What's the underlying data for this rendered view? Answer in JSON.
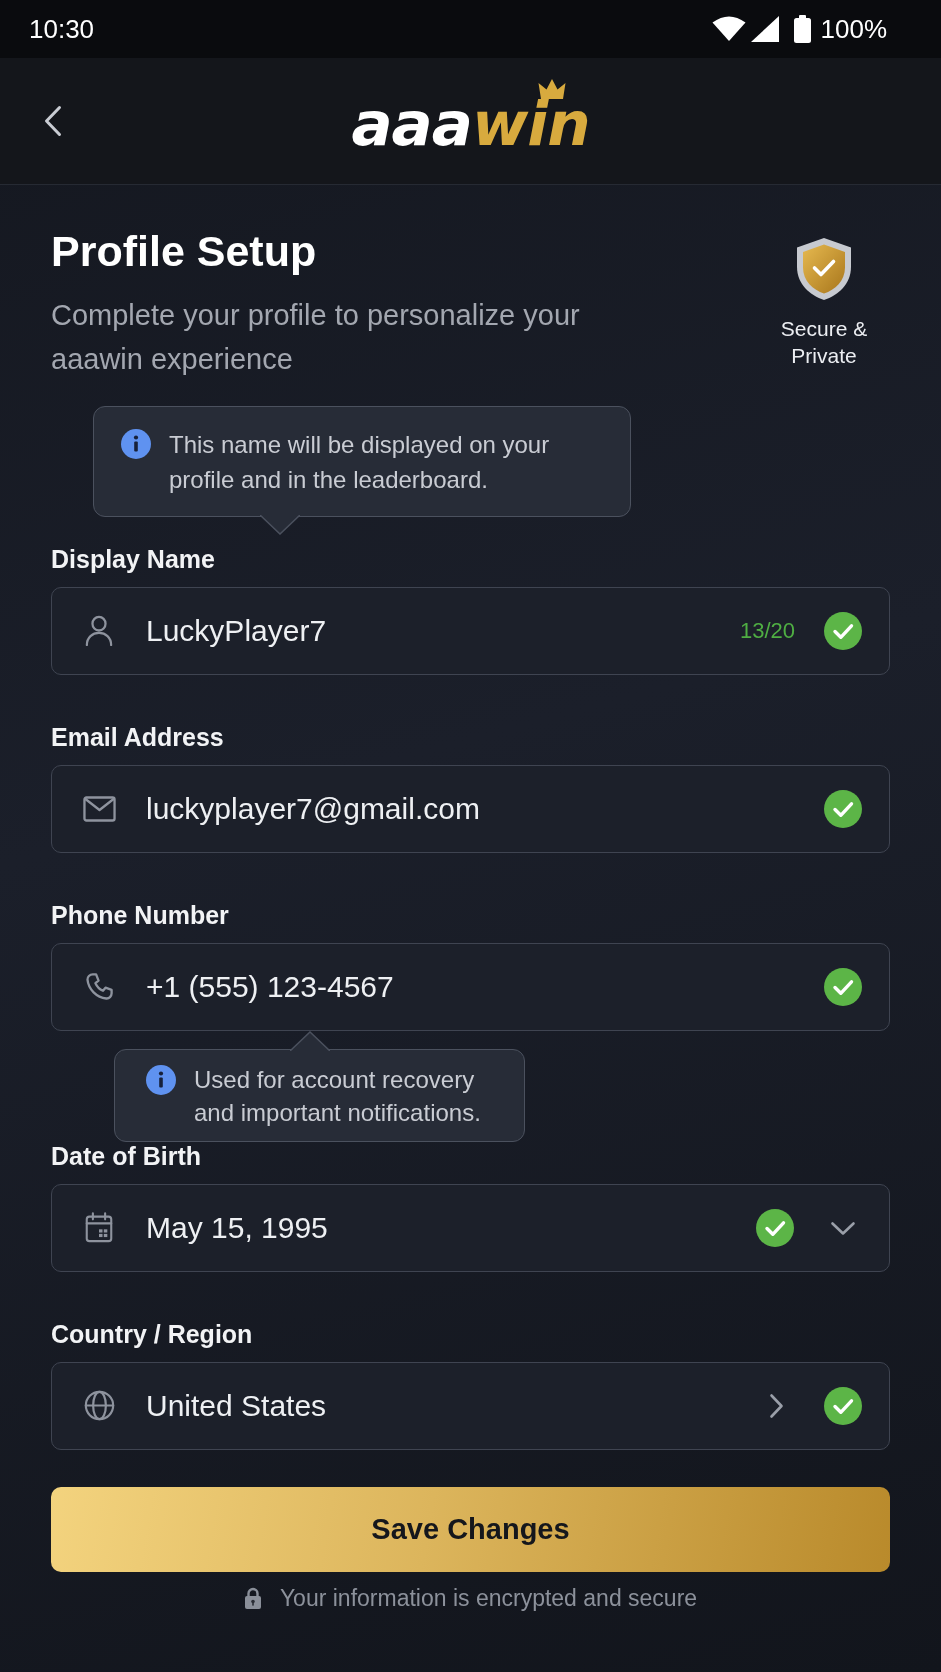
{
  "status_bar": {
    "time": "10:30",
    "battery": "100%"
  },
  "header": {
    "logo": [
      {
        "text": "aaa",
        "color": "#ffffff"
      },
      {
        "text": "win",
        "color": "#d8aa3e"
      }
    ]
  },
  "intro": {
    "title": "Profile Setup",
    "subtitle": "Complete your profile to personalize your aaawin experience",
    "badge": "Secure & Private"
  },
  "fields": [
    {
      "kind": "name",
      "label": "Display Name",
      "value": "LuckyPlayer7",
      "counter": "13/20",
      "valid": true,
      "tooltip_above": "This name will be displayed on your profile and in the leaderboard."
    },
    {
      "kind": "email",
      "label": "Email Address",
      "value": "luckyplayer7@gmail.com",
      "valid": true
    },
    {
      "kind": "phone",
      "label": "Phone Number",
      "value": "+1 (555) 123-4567",
      "valid": true,
      "tooltip_below": "Used for account recovery and important notifications."
    },
    {
      "kind": "date",
      "label": "Date of Birth",
      "value": "May 15, 1995",
      "valid": true
    },
    {
      "kind": "country",
      "label": "Country / Region",
      "value": "United States",
      "valid": true
    }
  ],
  "save_button": "Save Changes",
  "footer_note": "Your information is encrypted and secure"
}
